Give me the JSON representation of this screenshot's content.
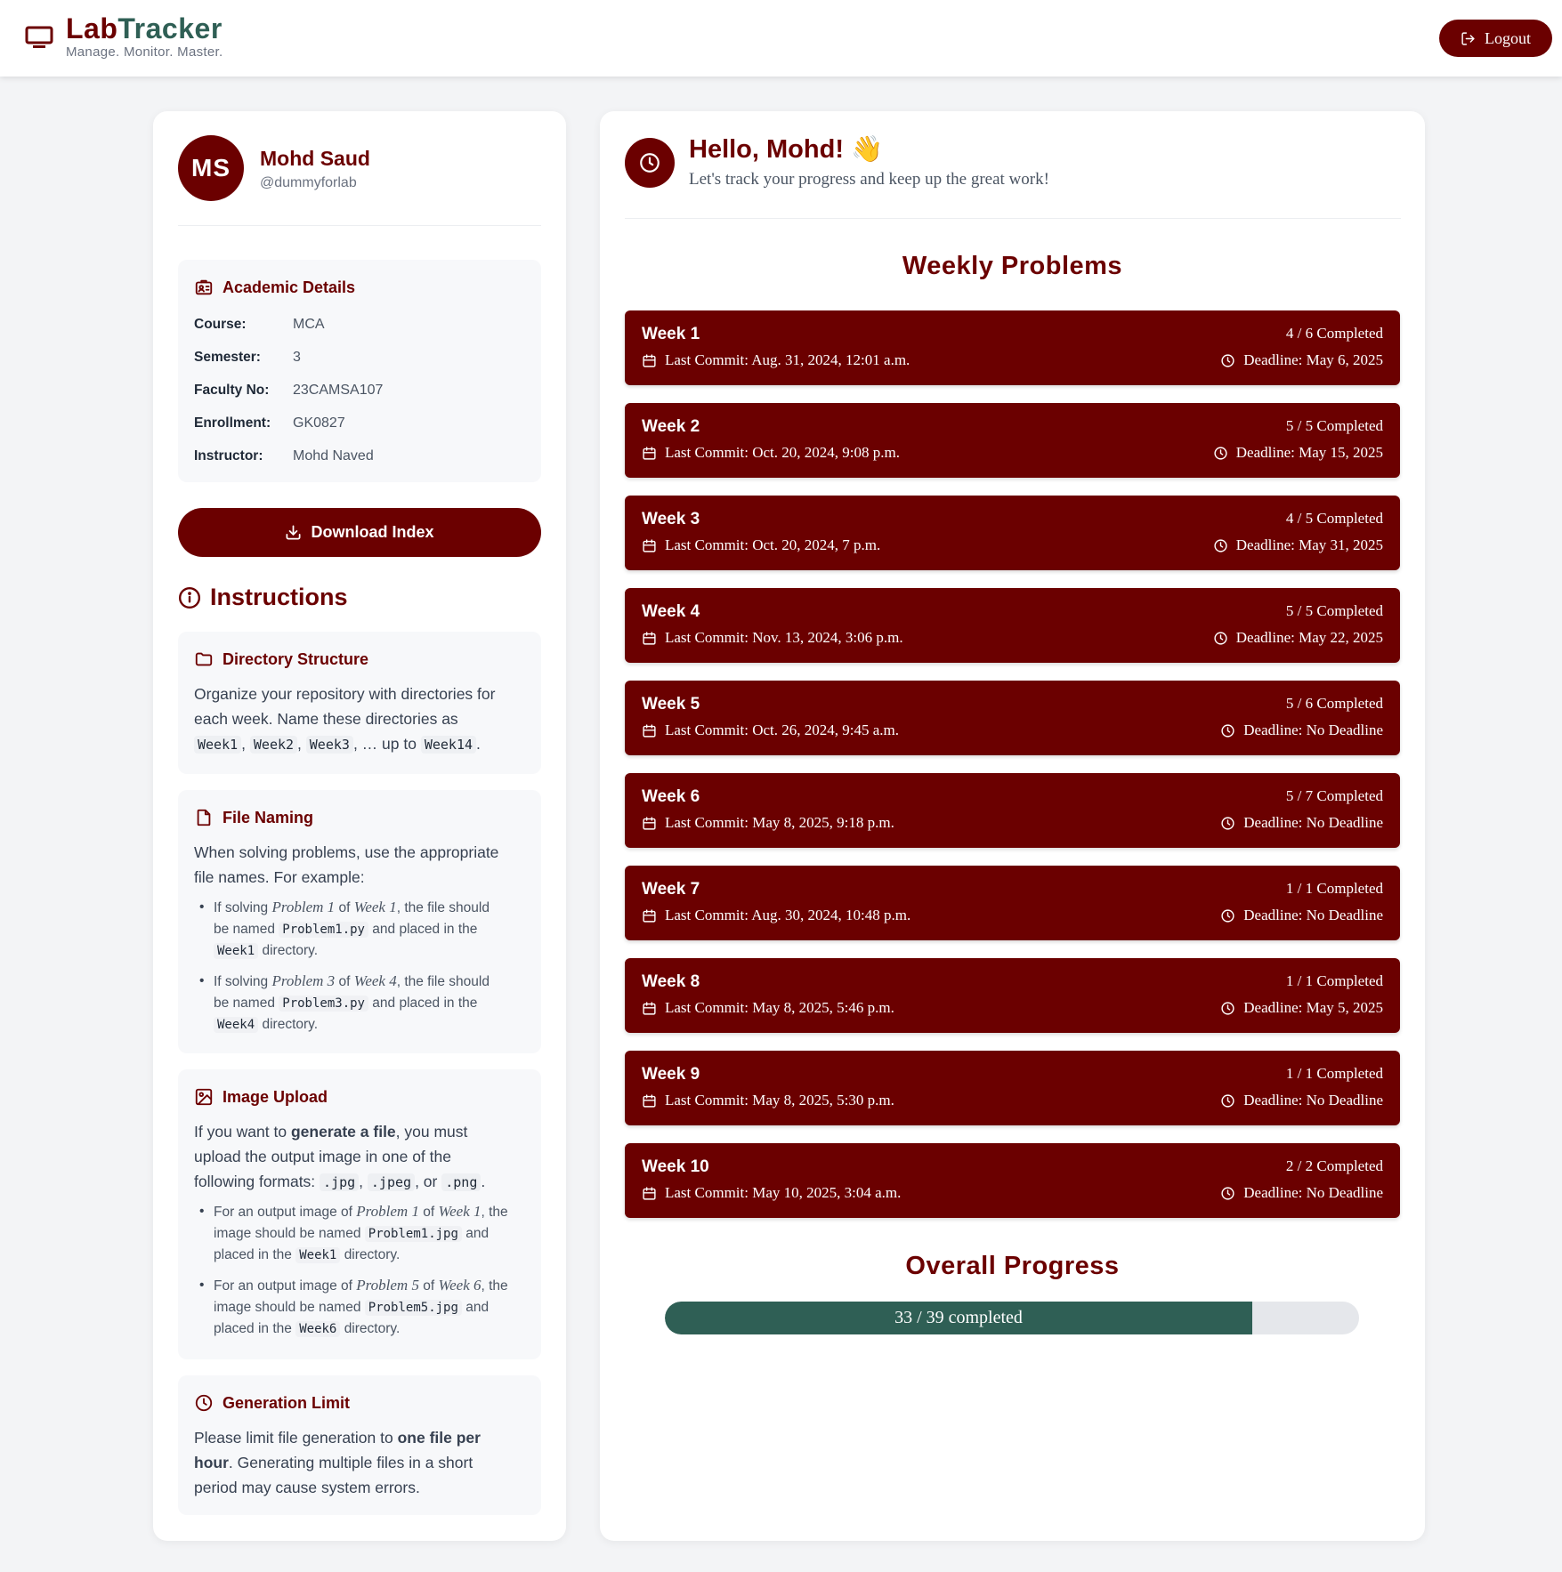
{
  "header": {
    "brand_part1": "Lab",
    "brand_part2": "Tracker",
    "tagline": "Manage. Monitor. Master.",
    "logout_label": "Logout",
    "icons": {
      "brand": "monitor-icon",
      "logout": "logout-icon"
    }
  },
  "colors": {
    "accent": "#6b0000",
    "secondary": "#2f5f55",
    "background": "#f3f4f6"
  },
  "profile": {
    "initials": "MS",
    "name": "Mohd Saud",
    "handle": "@dummyforlab"
  },
  "academic": {
    "title": "Academic Details",
    "rows": [
      {
        "label": "Course:",
        "value": "MCA"
      },
      {
        "label": "Semester:",
        "value": "3"
      },
      {
        "label": "Faculty No:",
        "value": "23CAMSA107"
      },
      {
        "label": "Enrollment:",
        "value": "GK0827"
      },
      {
        "label": "Instructor:",
        "value": "Mohd Naved"
      }
    ]
  },
  "download_label": "Download Index",
  "instructions": {
    "title": "Instructions",
    "directory": {
      "title": "Directory Structure",
      "line1": "Organize your repository with directories for",
      "line2": "each week. Name these directories as",
      "code1": "Week1",
      "code2": "Week2",
      "code3": "Week3",
      "upto": "… up to",
      "code4": "Week14"
    },
    "file_naming": {
      "title": "File Naming",
      "line1": "When solving problems, use the appropriate",
      "line2": "file names. For example:",
      "b1": {
        "pre": "If solving",
        "prob": "Problem 1",
        "of": "of",
        "week": "Week 1",
        "post": ", the file should",
        "named": "be named",
        "file": "Problem1.py",
        "placed": "and placed in the",
        "dir": "Week1",
        "dirword": "directory."
      },
      "b2": {
        "pre": "If solving",
        "prob": "Problem 3",
        "of": "of",
        "week": "Week 4",
        "post": ", the file should",
        "named": "be named",
        "file": "Problem3.py",
        "placed": "and placed in the",
        "dir": "Week4",
        "dirword": "directory."
      }
    },
    "image_upload": {
      "title": "Image Upload",
      "l1a": "If you want to",
      "l1b": "generate a file",
      "l1c": ", you must",
      "line2": "upload the output image in one of the",
      "line3": "following formats:",
      "f1": ".jpg",
      "f2": ".jpeg",
      "or": ", or",
      "f3": ".png",
      "b1": {
        "pre": "For an output image of",
        "prob": "Problem 1",
        "of": "of",
        "week": "Week 1",
        "post": ", the",
        "named": "image should be named",
        "file": "Problem1.jpg",
        "and": "and",
        "placed": "placed in the",
        "dir": "Week1",
        "dirword": "directory."
      },
      "b2": {
        "pre": "For an output image of",
        "prob": "Problem 5",
        "of": "of",
        "week": "Week 6",
        "post": ", the",
        "named": "image should be named",
        "file": "Problem5.jpg",
        "and": "and",
        "placed": "placed in the",
        "dir": "Week6",
        "dirword": "directory."
      }
    },
    "generation": {
      "title": "Generation Limit",
      "l1a": "Please limit file generation to",
      "l1b": "one file per",
      "l2a": "hour",
      "l2b": ". Generating multiple files in a short",
      "line3": "period may cause system errors."
    }
  },
  "greeting": {
    "title": "Hello, Mohd! 👋",
    "subtitle": "Let's track your progress and keep up the great work!"
  },
  "weekly_title": "Weekly Problems",
  "weeks": [
    {
      "name": "Week 1",
      "count": "4 / 6 Completed",
      "commit": "Last Commit: Aug. 31, 2024, 12:01 a.m.",
      "deadline": "Deadline: May 6, 2025"
    },
    {
      "name": "Week 2",
      "count": "5 / 5 Completed",
      "commit": "Last Commit: Oct. 20, 2024, 9:08 p.m.",
      "deadline": "Deadline: May 15, 2025"
    },
    {
      "name": "Week 3",
      "count": "4 / 5 Completed",
      "commit": "Last Commit: Oct. 20, 2024, 7 p.m.",
      "deadline": "Deadline: May 31, 2025"
    },
    {
      "name": "Week 4",
      "count": "5 / 5 Completed",
      "commit": "Last Commit: Nov. 13, 2024, 3:06 p.m.",
      "deadline": "Deadline: May 22, 2025"
    },
    {
      "name": "Week 5",
      "count": "5 / 6 Completed",
      "commit": "Last Commit: Oct. 26, 2024, 9:45 a.m.",
      "deadline": "Deadline: No Deadline"
    },
    {
      "name": "Week 6",
      "count": "5 / 7 Completed",
      "commit": "Last Commit: May 8, 2025, 9:18 p.m.",
      "deadline": "Deadline: No Deadline"
    },
    {
      "name": "Week 7",
      "count": "1 / 1 Completed",
      "commit": "Last Commit: Aug. 30, 2024, 10:48 p.m.",
      "deadline": "Deadline: No Deadline"
    },
    {
      "name": "Week 8",
      "count": "1 / 1 Completed",
      "commit": "Last Commit: May 8, 2025, 5:46 p.m.",
      "deadline": "Deadline: May 5, 2025"
    },
    {
      "name": "Week 9",
      "count": "1 / 1 Completed",
      "commit": "Last Commit: May 8, 2025, 5:30 p.m.",
      "deadline": "Deadline: No Deadline"
    },
    {
      "name": "Week 10",
      "count": "2 / 2 Completed",
      "commit": "Last Commit: May 10, 2025, 3:04 a.m.",
      "deadline": "Deadline: No Deadline"
    }
  ],
  "progress": {
    "title": "Overall Progress",
    "label": "33 / 39 completed",
    "completed": 33,
    "total": 39
  }
}
